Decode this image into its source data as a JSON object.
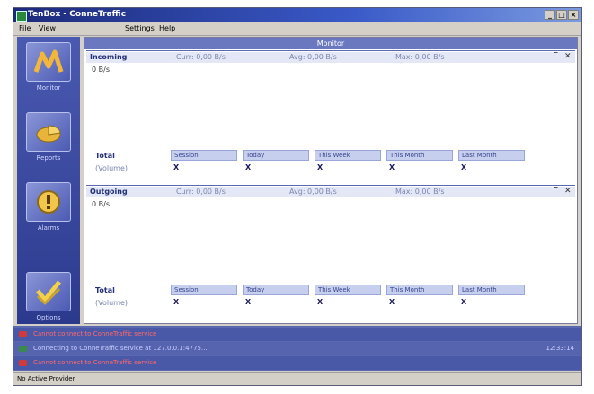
{
  "window": {
    "title": "TenBox - ConneTraffic",
    "controls": [
      "_",
      "□",
      "×"
    ]
  },
  "menu": [
    "File",
    "View",
    "Settings",
    "Help"
  ],
  "sidebar": {
    "items": [
      {
        "label": "Monitor",
        "icon": "monitor-icon"
      },
      {
        "label": "Reports",
        "icon": "reports-icon"
      },
      {
        "label": "Alarms",
        "icon": "alarm-icon"
      },
      {
        "label": "Options",
        "icon": "options-icon"
      }
    ]
  },
  "content": {
    "header": "Monitor"
  },
  "panels": [
    {
      "name": "Incoming",
      "curr": "Curr: 0,00 B/s",
      "avg": "Avg: 0,00 B/s",
      "max": "Max: 0,00 B/s",
      "rate": "0 B/s",
      "total_label": "Total",
      "unit_label": "(Volume)",
      "columns": [
        "Session",
        "Today",
        "This Week",
        "This Month",
        "Last Month"
      ],
      "values": [
        "X",
        "X",
        "X",
        "X",
        "X"
      ]
    },
    {
      "name": "Outgoing",
      "curr": "Curr: 0,00 B/s",
      "avg": "Avg: 0,00 B/s",
      "max": "Max: 0,00 B/s",
      "rate": "0 B/s",
      "total_label": "Total",
      "unit_label": "(Volume)",
      "columns": [
        "Session",
        "Today",
        "This Week",
        "This Month",
        "Last Month"
      ],
      "values": [
        "X",
        "X",
        "X",
        "X",
        "X"
      ]
    }
  ],
  "log": [
    {
      "text": "Cannot connect to ConneTraffic service",
      "time": "",
      "status": "error"
    },
    {
      "text": "Connecting to ConneTraffic service at 127.0.0.1:4775...",
      "time": "12:33:14",
      "status": "ok"
    },
    {
      "text": "Cannot connect to ConneTraffic service",
      "time": "",
      "status": "error"
    }
  ],
  "statusbar": {
    "text": "No Active Provider"
  },
  "colors": {
    "error": "#d23a3a",
    "ok": "#3a8a4a",
    "title_start": "#1c2a7a",
    "sidebar": "#2c3a8e"
  }
}
